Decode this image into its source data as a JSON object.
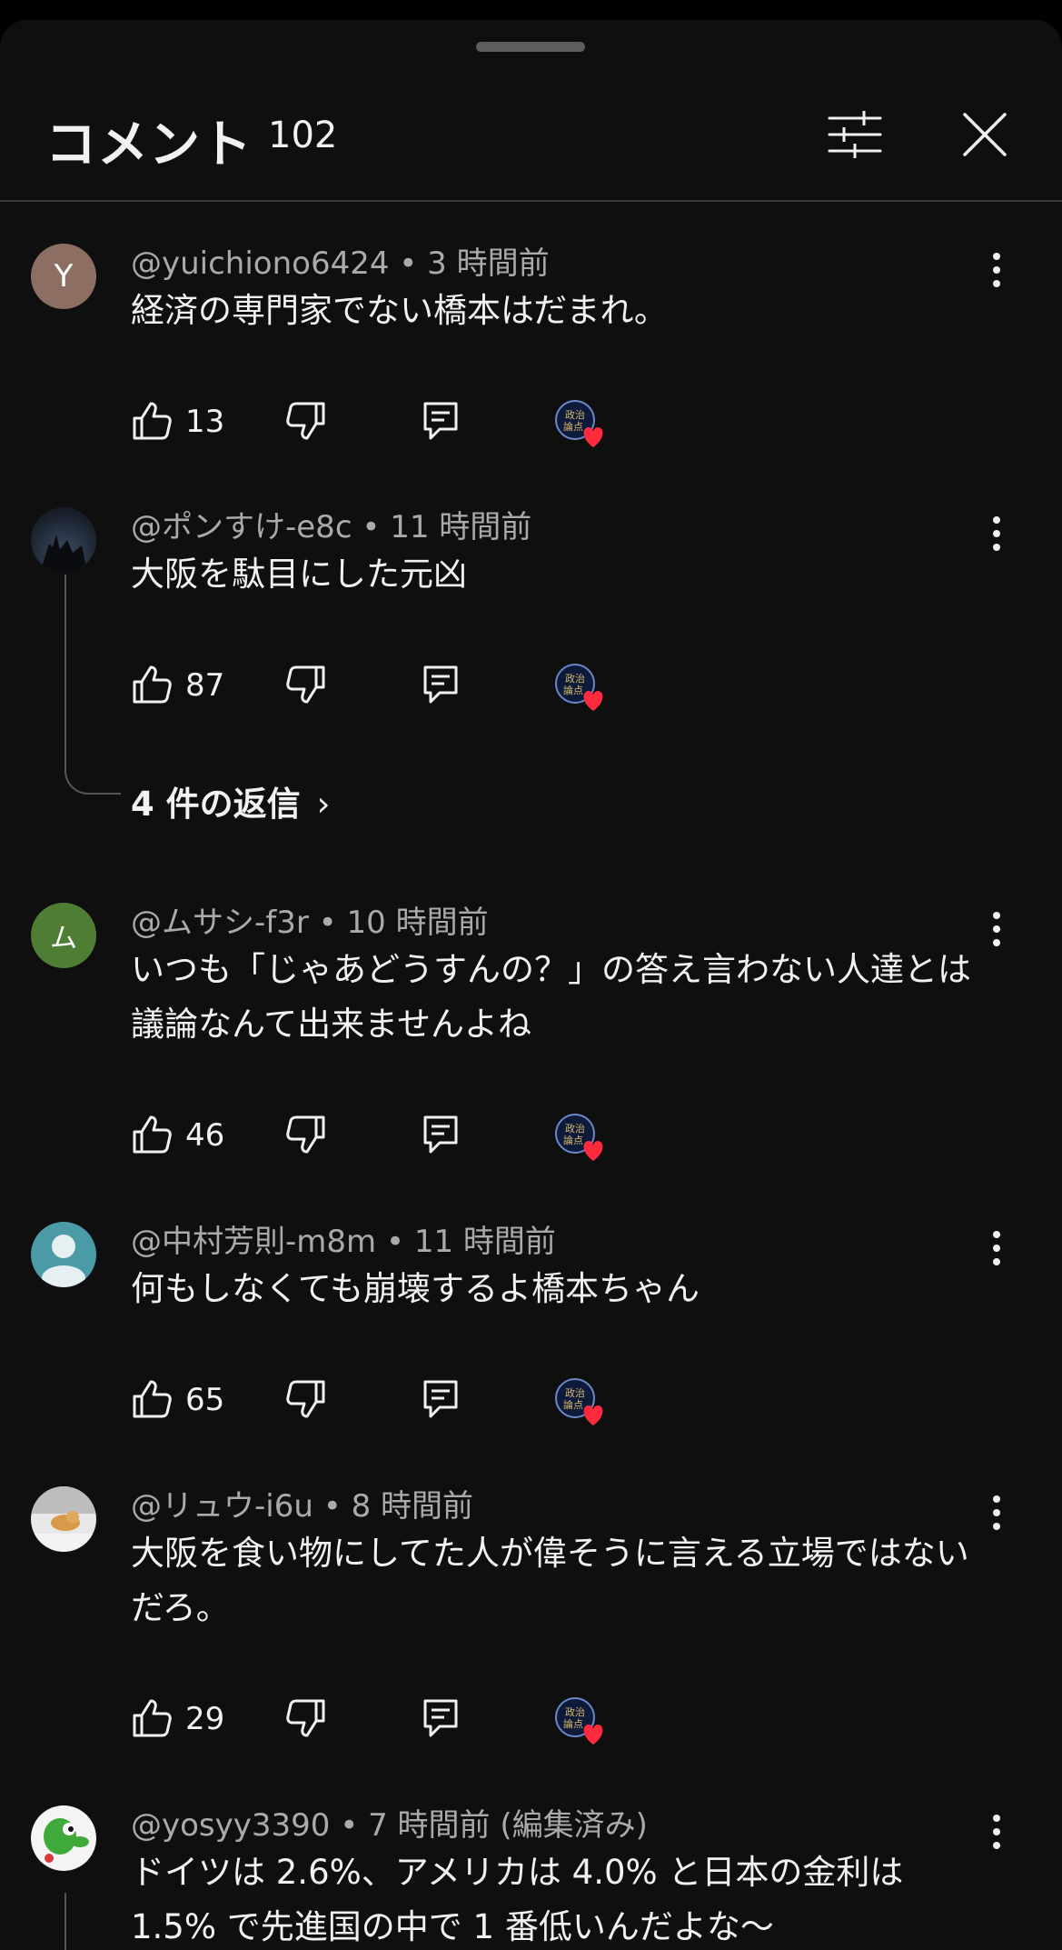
{
  "header": {
    "title": "コメント",
    "count": "102"
  },
  "comments": [
    {
      "avatar_letter": "Y",
      "avatar_color": "#8d6e63",
      "author": "@yuichiono6424",
      "time": "• 3 時間前",
      "text": "経済の専門家でない橋本はだまれ。",
      "likes": "13"
    },
    {
      "avatar_letter": "",
      "avatar_color": "#1f2b3a",
      "author": "@ポンすけ-e8c",
      "time": "• 11 時間前",
      "text": "大阪を駄目にした元凶",
      "likes": "87",
      "replies": "4 件の返信"
    },
    {
      "avatar_letter": "ム",
      "avatar_color": "#4e7d33",
      "author": "@ムサシ-f3r",
      "time": "• 10 時間前",
      "text": "いつも「じゃあどうすんの？」の答え言わない人達とは議論なんて出来ませんよね",
      "likes": "46"
    },
    {
      "avatar_letter": "",
      "avatar_color": "#4a9aa8",
      "author": "@中村芳則-m8m",
      "time": "• 11 時間前",
      "text": "何もしなくても崩壊するよ橋本ちゃん",
      "likes": "65"
    },
    {
      "avatar_letter": "",
      "avatar_color": "#dcdcdc",
      "author": "@リュウ-i6u",
      "time": "• 8 時間前",
      "text": "大阪を食い物にしてた人が偉そうに言える立場ではないだろ。",
      "likes": "29"
    },
    {
      "avatar_letter": "",
      "avatar_color": "#f4f4f4",
      "author": "@yosyy3390",
      "time": "• 7 時間前 (編集済み)",
      "text": "ドイツは 2.6%、アメリカは 4.0% と日本の金利は 1.5% で先進国の中で 1 番低いんだよな～"
    }
  ],
  "creator_badge": "政治論点",
  "colors": {
    "background": "#0f0f0f",
    "heart": "#ff2a3d"
  }
}
